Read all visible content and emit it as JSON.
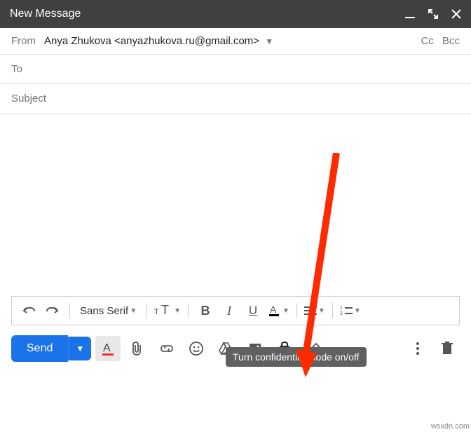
{
  "header": {
    "title": "New Message"
  },
  "from": {
    "label": "From",
    "value": "Anya Zhukova <anyazhukova.ru@gmail.com>",
    "cc": "Cc",
    "bcc": "Bcc"
  },
  "to": {
    "label": "To"
  },
  "subject": {
    "placeholder": "Subject"
  },
  "toolbar": {
    "font": "Sans Serif",
    "bold": "B",
    "italic": "I",
    "underline": "U"
  },
  "send": {
    "label": "Send"
  },
  "tooltip": {
    "text": "Turn confidential mode on/off"
  },
  "watermark": "wsxdn.com"
}
